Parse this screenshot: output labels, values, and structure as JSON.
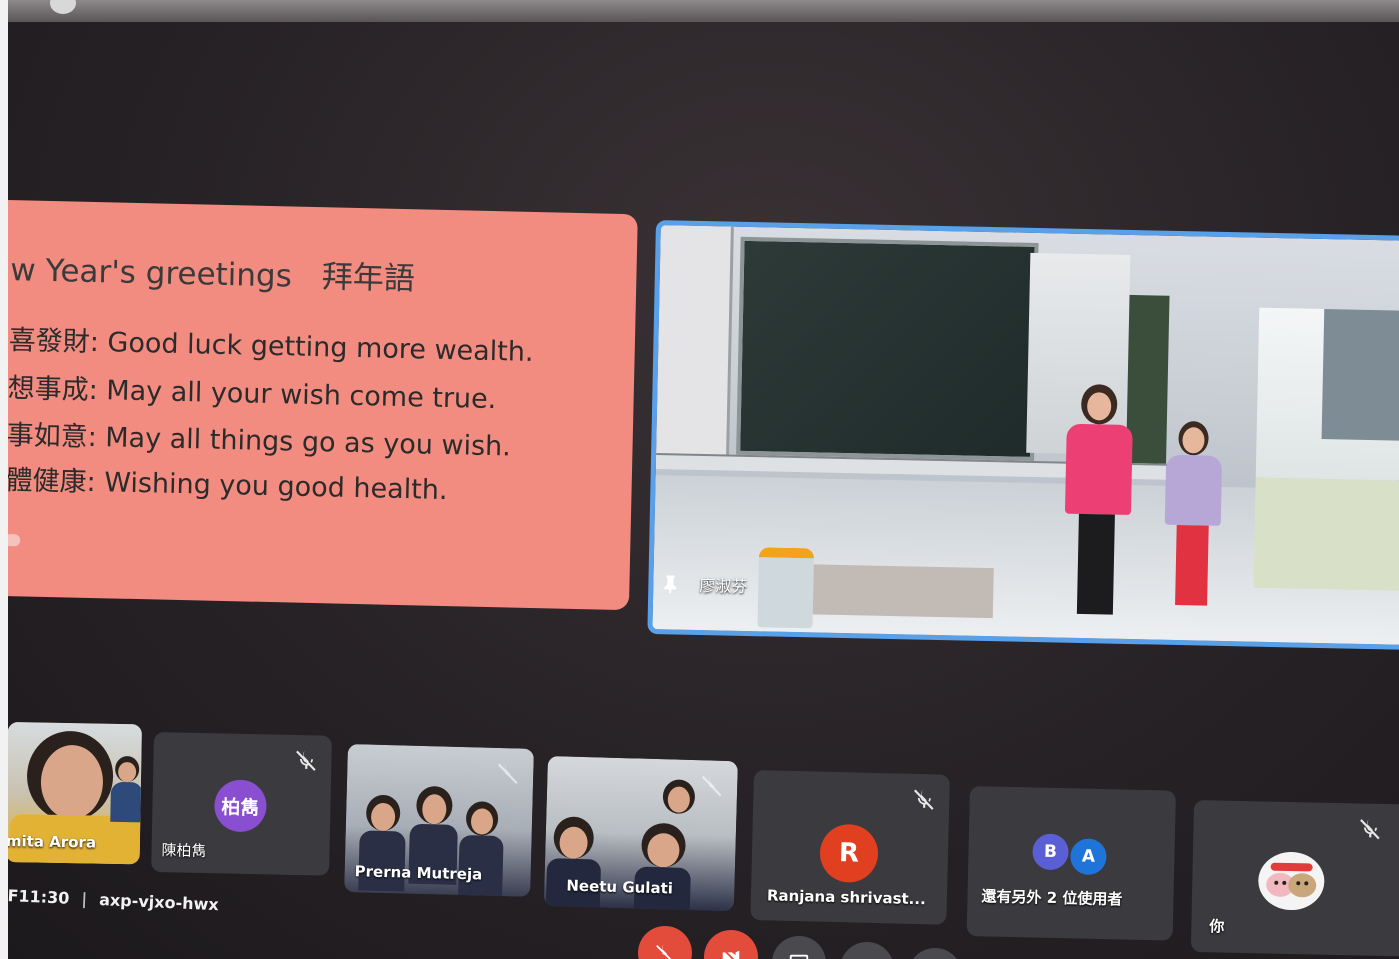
{
  "slide": {
    "title_en": "w Year's greetings",
    "title_zh": "拜年語",
    "lines": [
      "喜發財: Good luck getting more wealth.",
      "想事成: May all your wish come true.",
      "事如意: May all things go as you wish.",
      "體健康: Wishing you good health."
    ]
  },
  "featured": {
    "name": "廖淑芬",
    "pinned": true
  },
  "participants": [
    {
      "name": "mita Arora",
      "video": true,
      "muted": false
    },
    {
      "name": "陳柏雋",
      "avatar": "柏雋",
      "avatar_color": "#8a4fd0",
      "video": false,
      "muted": true
    },
    {
      "name": "Prerna Mutreja",
      "video": true,
      "muted": true
    },
    {
      "name": "Neetu Gulati",
      "video": true,
      "muted": true
    },
    {
      "name": "Ranjana shrivast...",
      "avatar": "R",
      "avatar_color": "#e0401f",
      "video": false,
      "muted": true
    },
    {
      "name": "還有另外 2 位使用者",
      "avatars": [
        "B",
        "A"
      ],
      "avatar_colors": [
        "#5b5fd6",
        "#1e74d8"
      ],
      "video": false
    },
    {
      "name": "你",
      "video": false,
      "muted": true
    }
  ],
  "meeting": {
    "time": "F11:30",
    "separator": "|",
    "code": "axp-vjxo-hwx"
  },
  "controls": [
    {
      "name": "mic-off",
      "color": "#e34b3b"
    },
    {
      "name": "camera-off",
      "color": "#e34b3b"
    },
    {
      "name": "present",
      "color": "#4a4a4e"
    },
    {
      "name": "raise-hand",
      "color": "#4a4a4e"
    },
    {
      "name": "more",
      "color": "#4a4a4e"
    }
  ]
}
